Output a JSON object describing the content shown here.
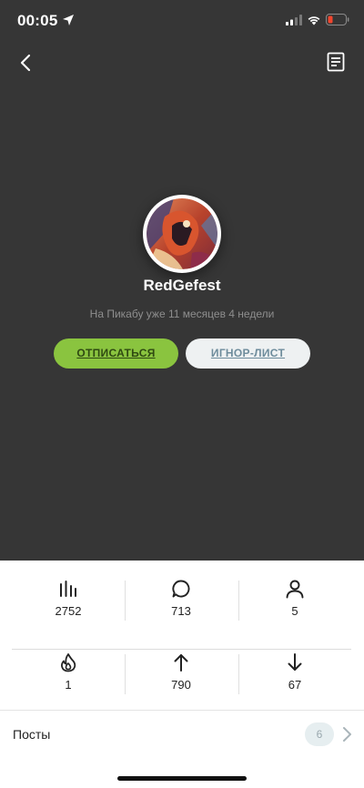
{
  "status_bar": {
    "time": "00:05"
  },
  "profile": {
    "username": "RedGefest",
    "since_text": "На Пикабу уже 11 месяцев 4 недели"
  },
  "actions": {
    "unsubscribe_label": "ОТПИСАТЬСЯ",
    "ignore_label": "ИГНОР-ЛИСТ"
  },
  "stats": [
    {
      "icon": "rating-bars-icon",
      "value": "2752"
    },
    {
      "icon": "comment-bubble-icon",
      "value": "713"
    },
    {
      "icon": "user-icon",
      "value": "5"
    },
    {
      "icon": "flame-icon",
      "value": "1"
    },
    {
      "icon": "arrow-up-icon",
      "value": "790"
    },
    {
      "icon": "arrow-down-icon",
      "value": "67"
    }
  ],
  "posts": {
    "label": "Посты",
    "count": "6"
  },
  "colors": {
    "hero_bg": "#363636",
    "accent_green": "#8ac43f",
    "ignore_bg": "#eef1f2",
    "battery_low": "#f2452d"
  }
}
